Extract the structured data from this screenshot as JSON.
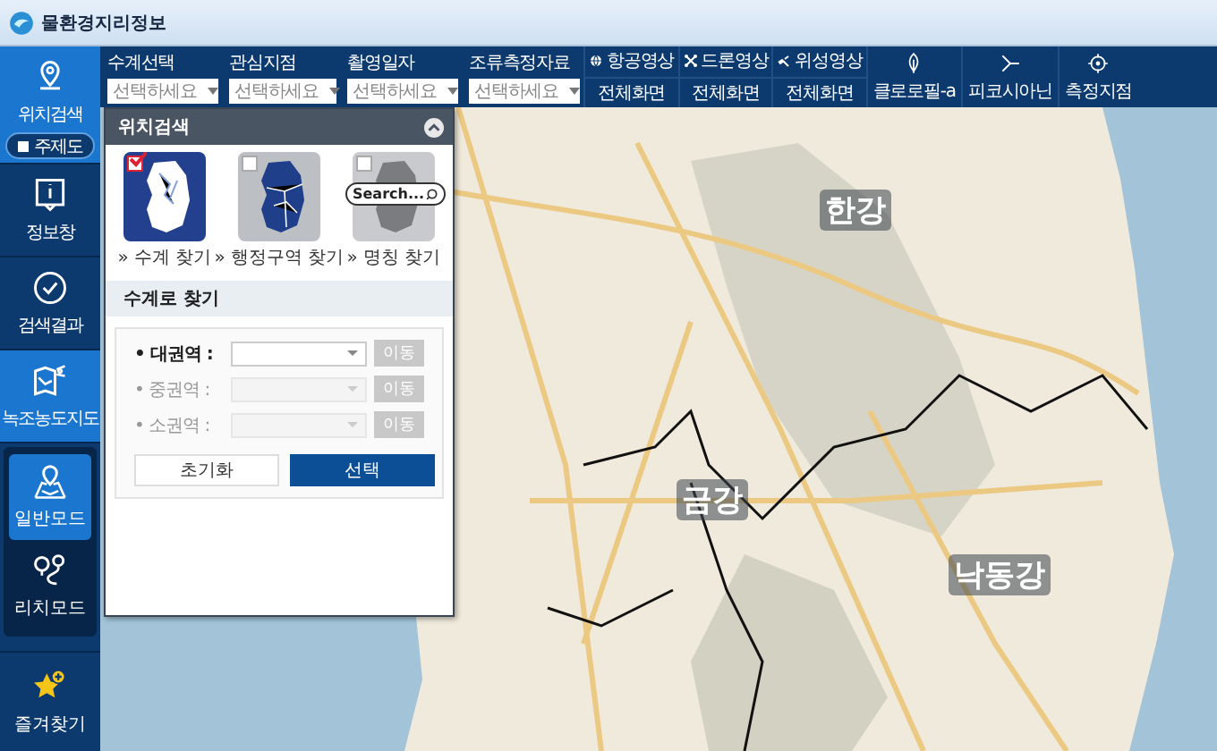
{
  "window": {
    "title": "물환경지리정보"
  },
  "sidebar": {
    "items": [
      {
        "label": "위치검색",
        "selected": true
      },
      {
        "label": "정보창",
        "selected": false
      },
      {
        "label": "검색결과",
        "selected": false
      },
      {
        "label": "녹조농도지도",
        "selected": true
      }
    ],
    "theme_toggle": {
      "label": "주제도"
    },
    "modes": [
      {
        "label": "일반모드",
        "selected": true
      },
      {
        "label": "리치모드",
        "selected": false
      }
    ],
    "favorites": {
      "label": "즐겨찾기"
    }
  },
  "filters": [
    {
      "label": "수계선택",
      "placeholder": "선택하세요"
    },
    {
      "label": "관심지점",
      "placeholder": "선택하세요"
    },
    {
      "label": "촬영일자",
      "placeholder": "선택하세요"
    },
    {
      "label": "조류측정자료",
      "placeholder": "선택하세요"
    }
  ],
  "imagery_buttons": [
    {
      "label": "항공영상",
      "action": "전체화면"
    },
    {
      "label": "드론영상",
      "action": "전체화면"
    },
    {
      "label": "위성영상",
      "action": "전체화면"
    }
  ],
  "layer_buttons": [
    {
      "label": "클로로필-a"
    },
    {
      "label": "피코시아닌"
    },
    {
      "label": "측정지점"
    }
  ],
  "panel": {
    "title": "위치검색",
    "search_modes": [
      {
        "label": "» 수계 찾기",
        "selected": true
      },
      {
        "label": "» 행정구역 찾기",
        "selected": false
      },
      {
        "label": "» 명칭 찾기",
        "selected": false
      }
    ],
    "search_hint": "Search...",
    "section_title": "수계로 찾기",
    "fields": [
      {
        "label": "• 대권역 :",
        "disabled": false,
        "button": "이동"
      },
      {
        "label": "• 중권역 :",
        "disabled": true,
        "button": "이동"
      },
      {
        "label": "• 소권역 :",
        "disabled": true,
        "button": "이동"
      }
    ],
    "buttons": [
      {
        "label": "초기화",
        "kind": "secondary"
      },
      {
        "label": "선택",
        "kind": "primary"
      }
    ]
  },
  "map": {
    "kind": "picture",
    "basin_labels": [
      "한강",
      "금강",
      "낙동강"
    ]
  }
}
